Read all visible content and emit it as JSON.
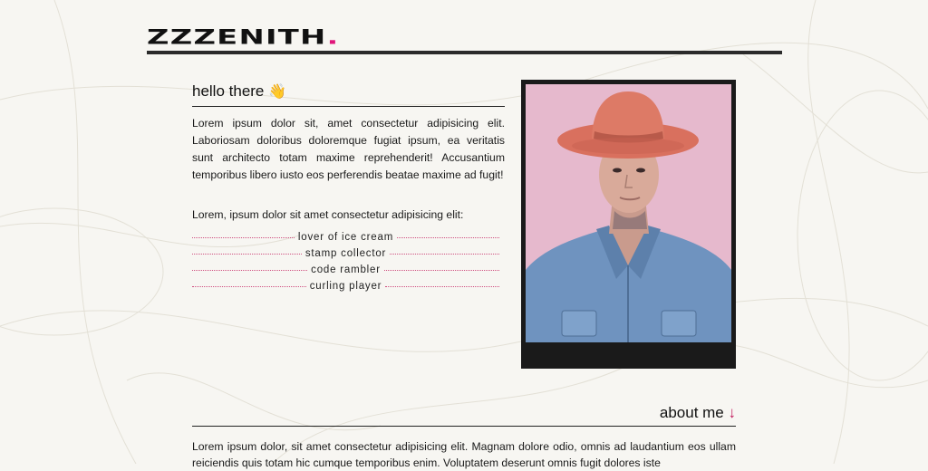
{
  "brand": {
    "name": "ZZZENITH",
    "dot": ".",
    "accent": "#e0157a"
  },
  "hello": {
    "title": "hello there",
    "emoji": "👋",
    "paragraph": "Lorem ipsum dolor sit, amet consectetur adipisicing elit. Laboriosam doloribus doloremque fugiat ipsum, ea veritatis sunt architecto totam maxime reprehenderit! Accusantium temporibus libero iusto eos perferendis beatae maxime ad fugit!",
    "intro": "Lorem, ipsum dolor sit amet consectetur adipisicing elit:",
    "likes": [
      "lover of ice cream",
      "stamp collector",
      "code rambler",
      "curling player"
    ]
  },
  "photo": {
    "subject": "portrait-man-hat-denim-shirt"
  },
  "about": {
    "title": "about me",
    "arrow": "↓",
    "paragraph": "Lorem ipsum dolor, sit amet consectetur adipisicing elit. Magnam dolore odio, omnis ad laudantium eos ullam reiciendis quis totam hic cumque temporibus enim. Voluptatem deserunt omnis fugit dolores iste"
  },
  "colors": {
    "background": "#f7f6f2",
    "text": "#1c1c1c",
    "accent": "#e0157a",
    "frame": "#1a1a1a"
  }
}
